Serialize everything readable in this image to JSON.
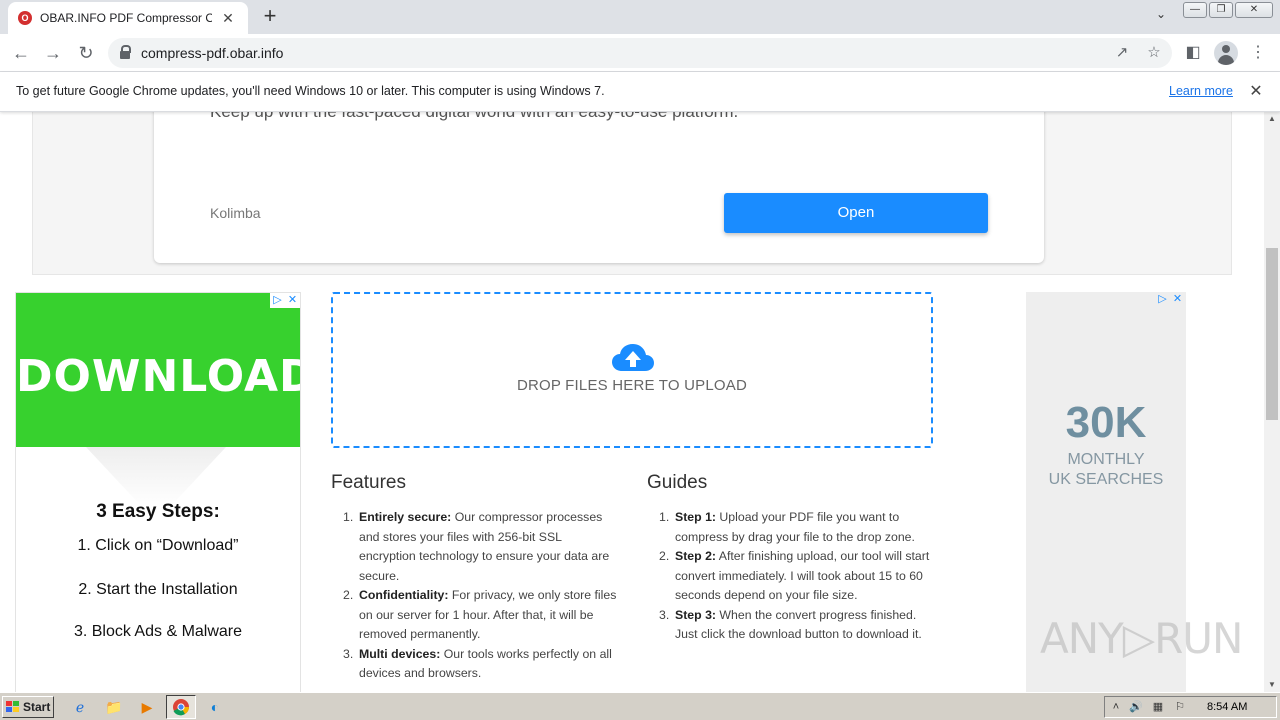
{
  "browser": {
    "tab_title": "OBAR.INFO PDF Compressor Online",
    "tab_favicon_letter": "O",
    "tab_close": "✕",
    "new_tab": "+",
    "url": "compress-pdf.obar.info"
  },
  "infobar": {
    "message": "To get future Google Chrome updates, you'll need Windows 10 or later. This computer is using Windows 7.",
    "link": "Learn more",
    "close": "✕"
  },
  "top_ad": {
    "tagline": "Keep up with the fast-paced digital world with an easy-to-use platform.",
    "brand": "Kolimba",
    "button": "Open"
  },
  "left_ad": {
    "headline": "DOWNLOAD",
    "heading": "3 Easy Steps:",
    "steps": [
      "1. Click on “Download”",
      "2. Start the Installation",
      "3. Block Ads & Malware"
    ],
    "color": "#37d12e"
  },
  "dropzone": {
    "text": "DROP FILES HERE TO UPLOAD",
    "accent": "#1a8cff"
  },
  "features": {
    "title": "Features",
    "items": [
      {
        "num": "1.",
        "bold": "Entirely secure:",
        "text": " Our compressor processes and stores your files with 256-bit SSL encryption technology to ensure your data are secure."
      },
      {
        "num": "2.",
        "bold": "Confidentiality:",
        "text": " For privacy, we only store files on our server for 1 hour. After that, it will be removed permanently."
      },
      {
        "num": "3.",
        "bold": "Multi devices:",
        "text": " Our tools works perfectly on all devices and browsers."
      }
    ]
  },
  "guides": {
    "title": "Guides",
    "items": [
      {
        "num": "1.",
        "bold": "Step 1:",
        "text": " Upload your PDF file you want to compress by drag your file to the drop zone."
      },
      {
        "num": "2.",
        "bold": "Step 2:",
        "text": " After finishing upload, our tool will start convert immediately. I will took about 15 to 60 seconds depend on your file size."
      },
      {
        "num": "3.",
        "bold": "Step 3:",
        "text": " When the convert progress finished. Just click the download button to download it."
      }
    ]
  },
  "right_ad": {
    "big": "30K",
    "line1": "MONTHLY",
    "line2": "UK SEARCHES"
  },
  "watermark": "ANY▷RUN",
  "taskbar": {
    "start": "Start",
    "clock": "8:54 AM"
  }
}
